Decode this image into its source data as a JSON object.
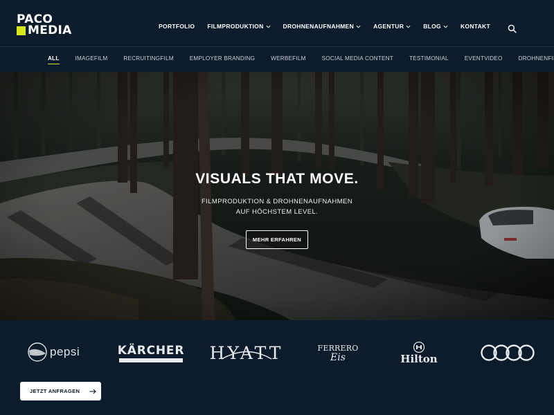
{
  "brand": {
    "line1": "PACO",
    "line2": "MEDIA",
    "accent": "#d8e61a"
  },
  "nav": {
    "items": [
      {
        "label": "PORTFOLIO",
        "dropdown": false
      },
      {
        "label": "FILMPRODUKTION",
        "dropdown": true
      },
      {
        "label": "DROHNENAUFNAHMEN",
        "dropdown": true
      },
      {
        "label": "AGENTUR",
        "dropdown": true
      },
      {
        "label": "BLOG",
        "dropdown": true
      },
      {
        "label": "KONTAKT",
        "dropdown": false
      }
    ],
    "search_icon": "search-icon"
  },
  "filters": [
    {
      "label": "ALL",
      "active": true
    },
    {
      "label": "IMAGEFILM"
    },
    {
      "label": "RECRUITINGFILM"
    },
    {
      "label": "EMPLOYER BRANDING"
    },
    {
      "label": "WERBEFILM"
    },
    {
      "label": "SOCIAL MEDIA CONTENT"
    },
    {
      "label": "TESTIMONIAL"
    },
    {
      "label": "EVENTVIDEO"
    },
    {
      "label": "DROHNENFILM"
    }
  ],
  "hero": {
    "title": "VISUALS THAT MOVE.",
    "subtitle_line1": "FILMPRODUKTION & DROHNENAUFNAHMEN",
    "subtitle_line2": "AUF HÖCHSTEM LEVEL.",
    "button_label": "MEHR ERFAHREN"
  },
  "clients": {
    "pepsi": "pepsi",
    "karcher": "KÄRCHER",
    "hyatt": "HYATT",
    "ferrero_line1": "FERRERO",
    "ferrero_line2": "Eis",
    "hilton": "Hilton",
    "audi_icon": "audi-rings-icon"
  },
  "cta": {
    "label": "JETZT ANFRAGEN",
    "icon": "arrow-right-icon"
  }
}
